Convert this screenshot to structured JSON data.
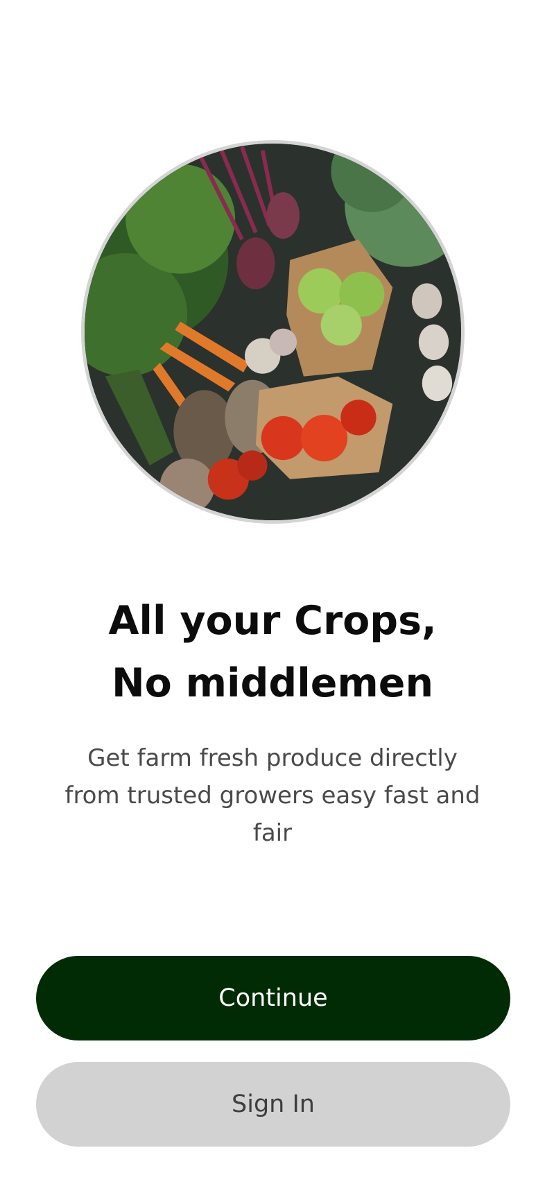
{
  "hero": {
    "image": "farm-produce-basket-photo"
  },
  "headline": {
    "line1": "All your Crops,",
    "line2": "No middlemen"
  },
  "subtext": "Get farm fresh produce directly from trusted growers easy fast and fair",
  "actions": {
    "continue_label": "Continue",
    "signin_label": "Sign In"
  },
  "colors": {
    "primary": "#012b04",
    "secondary_button": "#d2d2d2",
    "headline_text": "#0c0c0c",
    "body_text": "#4a4a4a"
  }
}
